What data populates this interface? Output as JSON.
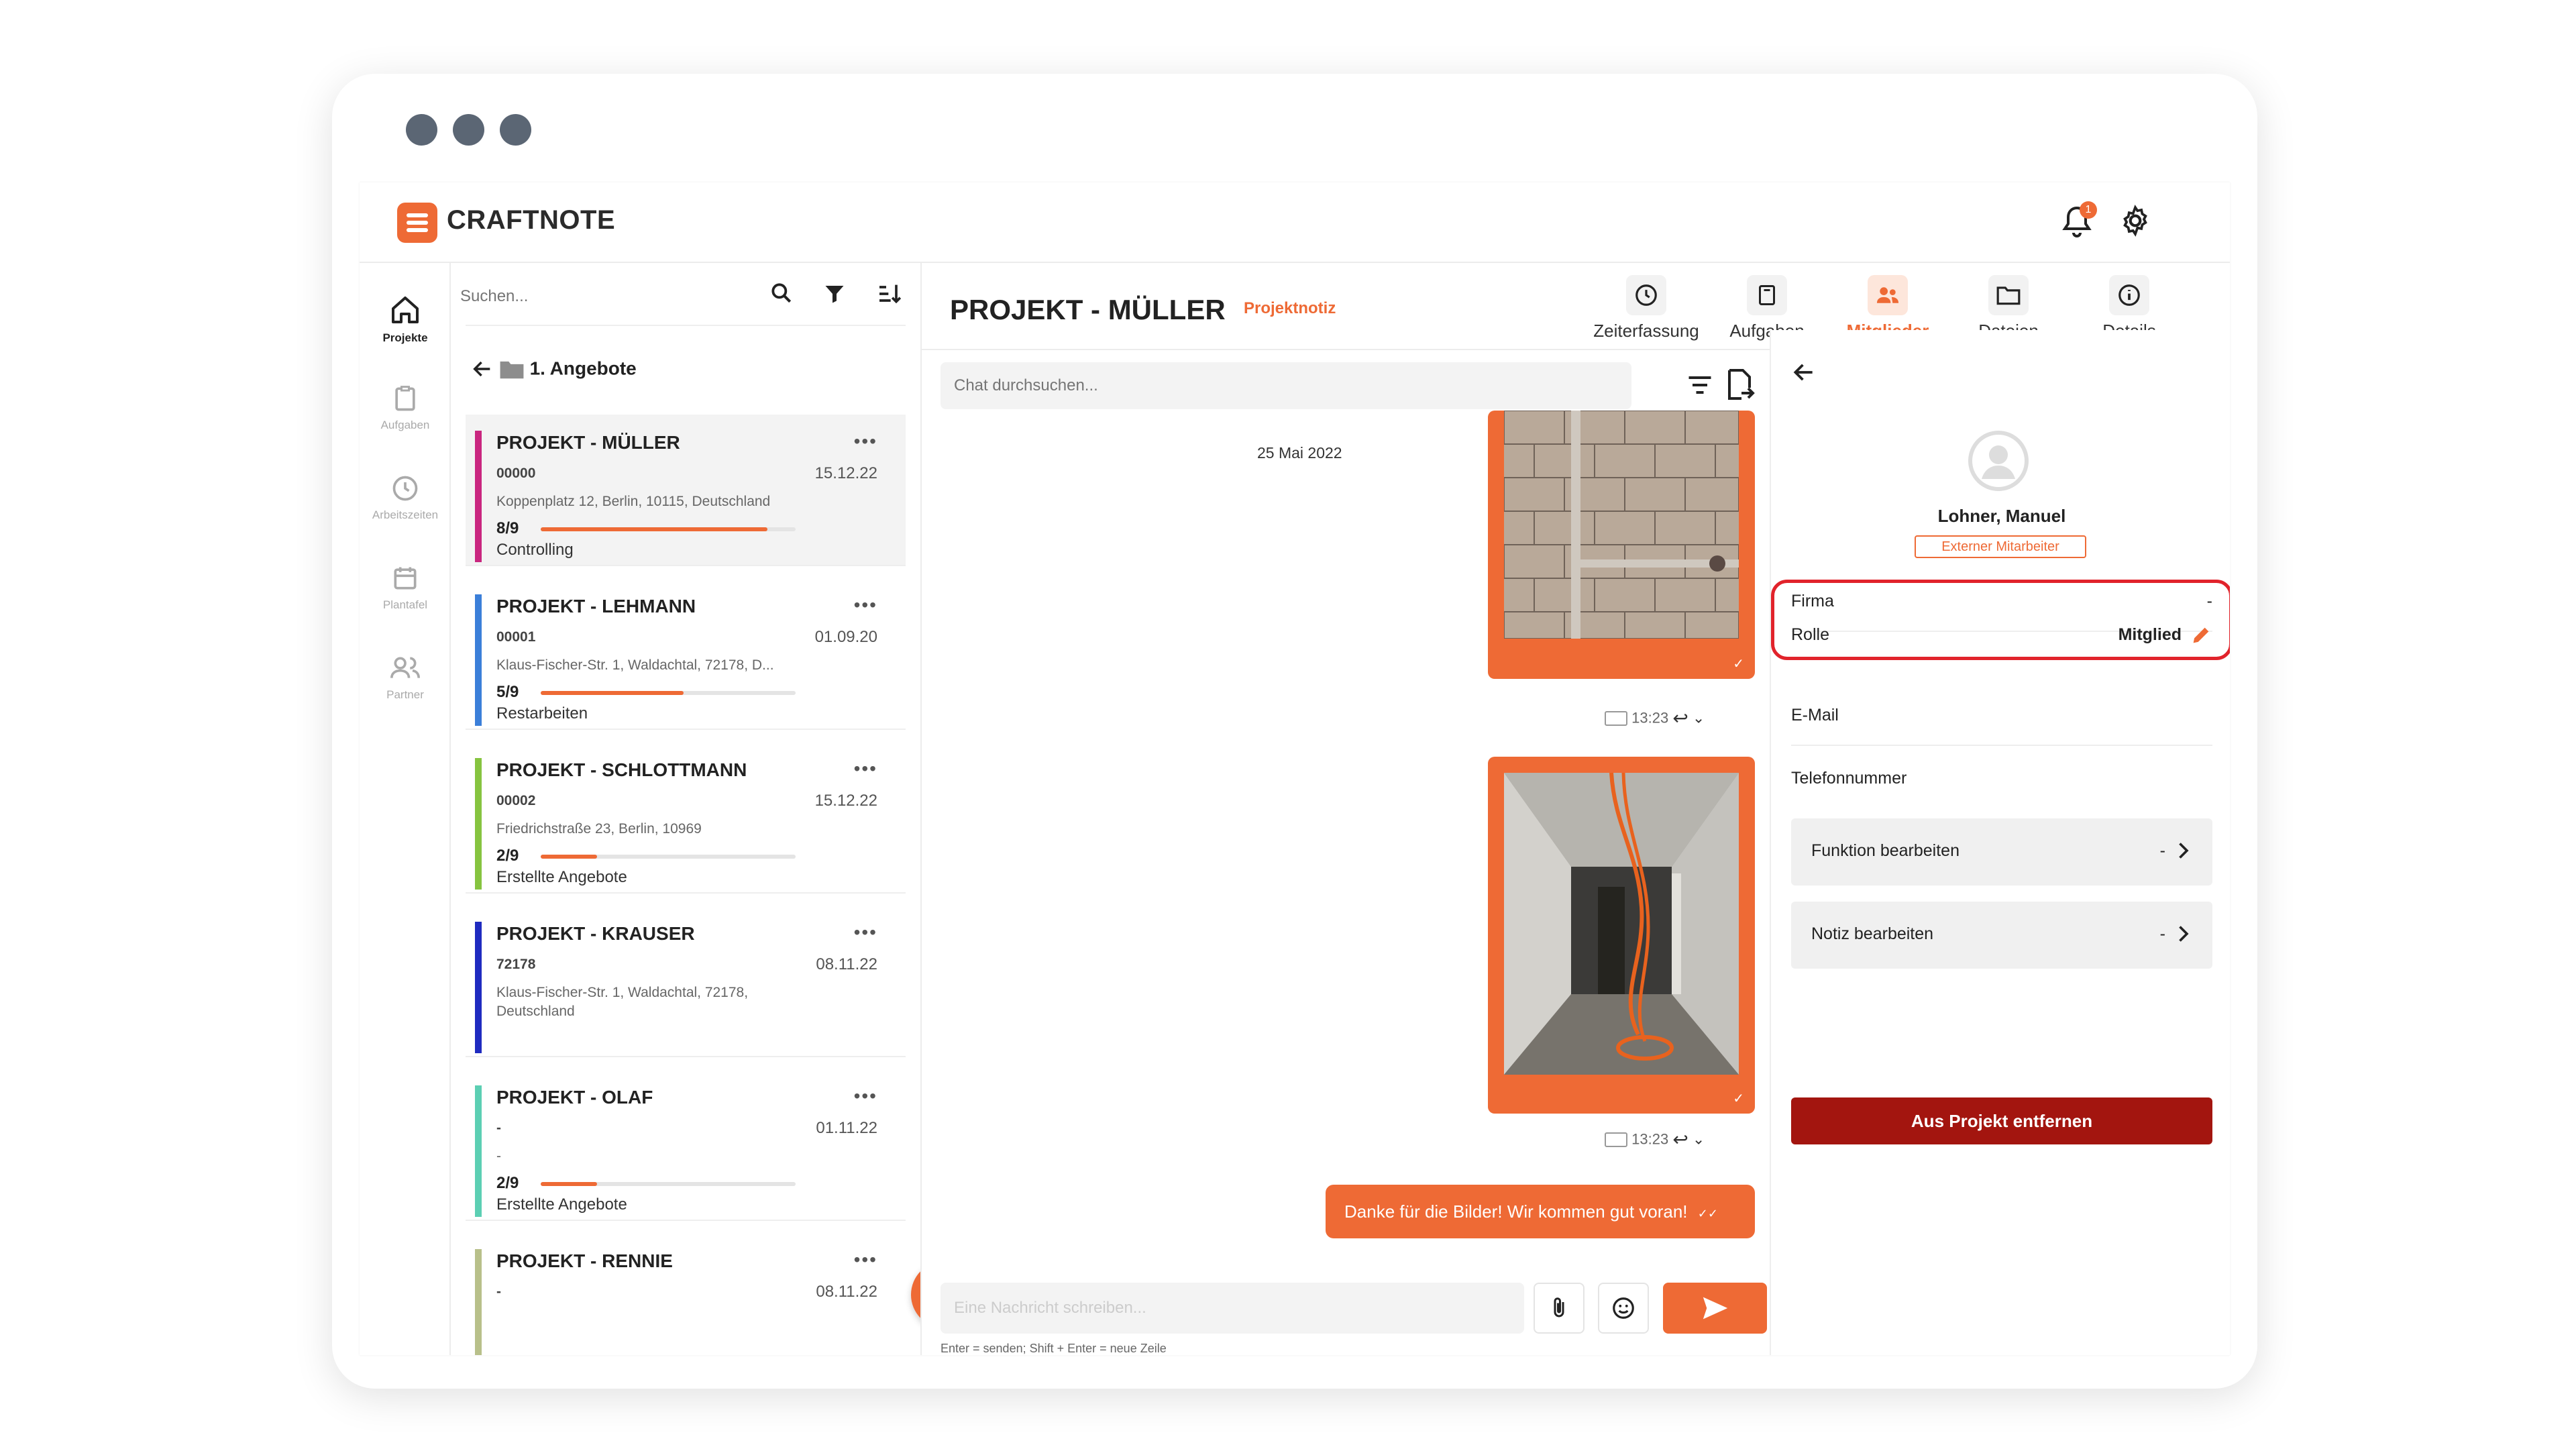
{
  "app": {
    "brand": "CRAFTNOTE",
    "notification_count": "1",
    "accent_color": "#ee6a35"
  },
  "rail": [
    {
      "label": "Projekte",
      "icon": "home-icon",
      "active": true
    },
    {
      "label": "Aufgaben",
      "icon": "clipboard-icon",
      "active": false
    },
    {
      "label": "Arbeitszeiten",
      "icon": "clock-icon",
      "active": false
    },
    {
      "label": "Plantafel",
      "icon": "calendar-icon",
      "active": false
    },
    {
      "label": "Partner",
      "icon": "people-icon",
      "active": false
    }
  ],
  "list": {
    "search_placeholder": "Suchen...",
    "folder": "1. Angebote",
    "projects": [
      {
        "title": "PROJEKT - MÜLLER",
        "number": "00000",
        "date": "15.12.22",
        "address": "Koppenplatz 12, Berlin, 10115, Deutschland",
        "progress": "8/9",
        "progress_value": 0.89,
        "phase": "Controlling",
        "color": "#c9267f"
      },
      {
        "title": "PROJEKT - LEHMANN",
        "number": "00001",
        "date": "01.09.20",
        "address": "Klaus-Fischer-Str. 1, Waldachtal, 72178, D...",
        "progress": "5/9",
        "progress_value": 0.56,
        "phase": "Restarbeiten",
        "color": "#3b7fd9"
      },
      {
        "title": "PROJEKT - SCHLOTTMANN",
        "number": "00002",
        "date": "15.12.22",
        "address": "Friedrichstraße 23, Berlin, 10969",
        "progress": "2/9",
        "progress_value": 0.22,
        "phase": "Erstellte Angebote",
        "color": "#86c440"
      },
      {
        "title": "PROJEKT - KRAUSER",
        "number": "72178",
        "date": "08.11.22",
        "address": "Klaus-Fischer-Str. 1, Waldachtal, 72178, Deutschland",
        "progress": "",
        "progress_value": null,
        "phase": "",
        "color": "#1f2bc0"
      },
      {
        "title": "PROJEKT - OLAF",
        "number": "-",
        "date": "01.11.22",
        "address": "-",
        "progress": "2/9",
        "progress_value": 0.22,
        "phase": "Erstellte Angebote",
        "color": "#5ccfb3"
      },
      {
        "title": "PROJEKT - RENNIE",
        "number": "-",
        "date": "08.11.22",
        "address": "",
        "progress": "",
        "progress_value": null,
        "phase": "",
        "color": "#b8c08a"
      }
    ]
  },
  "chat": {
    "project_title": "PROJEKT - MÜLLER",
    "project_tag": "Projektnotiz",
    "tabs": [
      {
        "label": "Zeiterfassung",
        "icon": "clock-icon",
        "active": false
      },
      {
        "label": "Aufgaben",
        "icon": "clipboard-icon",
        "active": false
      },
      {
        "label": "Mitglieder",
        "icon": "members-icon",
        "active": true
      },
      {
        "label": "Dateien",
        "icon": "folder-icon",
        "active": false
      },
      {
        "label": "Details",
        "icon": "info-icon",
        "active": false
      }
    ],
    "search_placeholder": "Chat durchsuchen...",
    "date_separator": "25 Mai 2022",
    "messages": [
      {
        "time": "13:23"
      },
      {
        "time": "13:23",
        "text": "Danke für die Bilder! Wir kommen gut voran!"
      }
    ],
    "compose_placeholder": "Eine Nachricht schreiben...",
    "hint": "Enter = senden; Shift + Enter = neue Zeile"
  },
  "member": {
    "name": "Lohner, Manuel",
    "type": "Externer Mitarbeiter",
    "fields": {
      "firma_label": "Firma",
      "firma_value": "-",
      "rolle_label": "Rolle",
      "rolle_value": "Mitglied",
      "email_label": "E-Mail",
      "phone_label": "Telefonnummer"
    },
    "funktion_label": "Funktion bearbeiten",
    "funktion_value": "-",
    "notiz_label": "Notiz bearbeiten",
    "notiz_value": "-",
    "remove_label": "Aus Projekt entfernen",
    "remove_color": "#a3150f",
    "highlight_color": "#e1232b"
  }
}
